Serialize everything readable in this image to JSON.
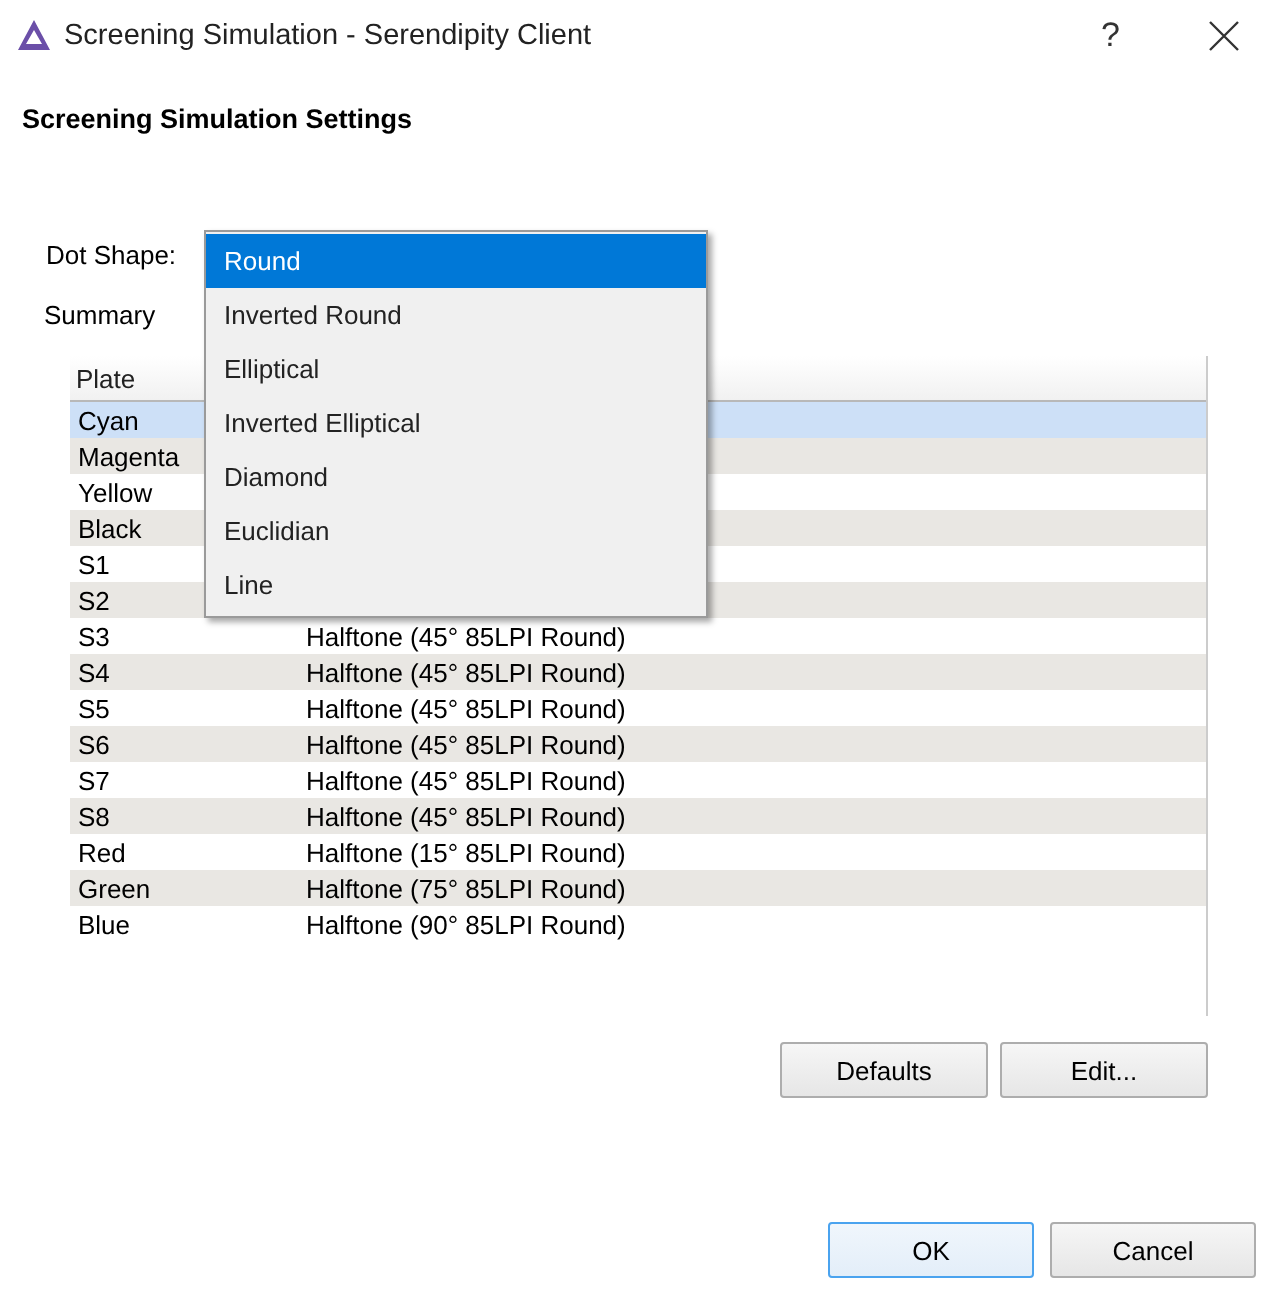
{
  "window": {
    "title": "Screening Simulation - Serendipity Client",
    "help": "?"
  },
  "heading": "Screening Simulation Settings",
  "dot_shape": {
    "label": "Dot Shape:",
    "options": [
      {
        "label": "Round",
        "selected": true
      },
      {
        "label": "Inverted Round",
        "selected": false
      },
      {
        "label": "Elliptical",
        "selected": false
      },
      {
        "label": "Inverted Elliptical",
        "selected": false
      },
      {
        "label": "Diamond",
        "selected": false
      },
      {
        "label": "Euclidian",
        "selected": false
      },
      {
        "label": "Line",
        "selected": false
      }
    ]
  },
  "summary": {
    "label": "Summary",
    "columns": [
      "Plate"
    ],
    "rows": [
      {
        "plate": "Cyan",
        "selected": true
      },
      {
        "plate": "Magenta",
        "selected": false
      },
      {
        "plate": "Yellow",
        "selected": false
      },
      {
        "plate": "Black",
        "selected": false
      },
      {
        "plate": "S1",
        "selected": false
      },
      {
        "plate": "S2",
        "selected": false
      },
      {
        "plate": "S3",
        "screening": "Halftone (45° 85LPI Round)",
        "selected": false
      },
      {
        "plate": "S4",
        "screening": "Halftone (45° 85LPI Round)",
        "selected": false
      },
      {
        "plate": "S5",
        "screening": "Halftone (45° 85LPI Round)",
        "selected": false
      },
      {
        "plate": "S6",
        "screening": "Halftone (45° 85LPI Round)",
        "selected": false
      },
      {
        "plate": "S7",
        "screening": "Halftone (45° 85LPI Round)",
        "selected": false
      },
      {
        "plate": "S8",
        "screening": "Halftone (45° 85LPI Round)",
        "selected": false
      },
      {
        "plate": "Red",
        "screening": "Halftone (15° 85LPI Round)",
        "selected": false
      },
      {
        "plate": "Green",
        "screening": "Halftone (75° 85LPI Round)",
        "selected": false
      },
      {
        "plate": "Blue",
        "screening": "Halftone (90° 85LPI Round)",
        "selected": false
      }
    ]
  },
  "table_buttons": [
    "Defaults",
    "Edit..."
  ],
  "dialog_buttons": [
    {
      "label": "OK",
      "default": true
    },
    {
      "label": "Cancel",
      "default": false
    }
  ]
}
